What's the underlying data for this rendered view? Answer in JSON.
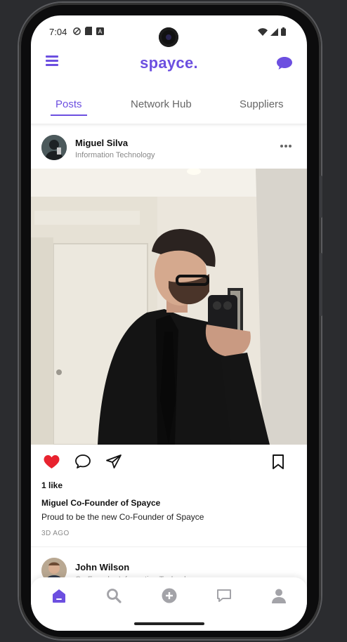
{
  "status_bar": {
    "time": "7:04"
  },
  "app": {
    "logo": "spayce."
  },
  "tabs": [
    {
      "label": "Posts",
      "active": true
    },
    {
      "label": "Network Hub",
      "active": false
    },
    {
      "label": "Suppliers",
      "active": false
    }
  ],
  "post": {
    "author": "Miguel Silva",
    "role": "Information Technology",
    "likes": "1 like",
    "caption_title": "Miguel Co-Founder of Spayce",
    "caption_text": "Proud to be the new Co-Founder of Spayce",
    "time_ago": "3D AGO",
    "liked": true
  },
  "next_post": {
    "author": "John Wilson",
    "role": "Co-Founder Information Technology"
  },
  "bottom_nav": [
    {
      "icon": "home-icon",
      "active": true
    },
    {
      "icon": "search-icon",
      "active": false
    },
    {
      "icon": "add-icon",
      "active": false
    },
    {
      "icon": "messages-icon",
      "active": false
    },
    {
      "icon": "profile-icon",
      "active": false
    }
  ],
  "colors": {
    "accent": "#6c4fe0",
    "like": "#e8232f",
    "nav_inactive": "#a3a3a8"
  }
}
